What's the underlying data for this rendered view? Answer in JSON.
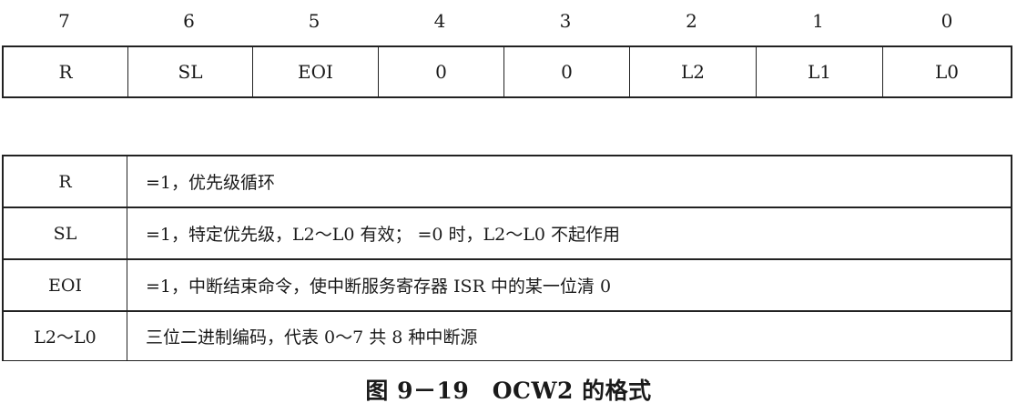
{
  "bit_numbers": [
    "7",
    "6",
    "5",
    "4",
    "3",
    "2",
    "1",
    "0"
  ],
  "bit_fields": [
    "R",
    "SL",
    "EOI",
    "0",
    "0",
    "L2",
    "L1",
    "L0"
  ],
  "descriptions": [
    {
      "key": "R",
      "value": "=1，优先级循环"
    },
    {
      "key": "SL",
      "value": "=1，特定优先级，L2～L0 有效； =0 时，L2～L0 不起作用"
    },
    {
      "key": "EOI",
      "value": "=1，中断结束命令，使中断服务寄存器 ISR 中的某一位清 0"
    },
    {
      "key": "L2～L0",
      "value": "三位二进制编码，代表 0～7 共 8 种中断源"
    }
  ],
  "caption": "图 9－19　OCW2 的格式"
}
